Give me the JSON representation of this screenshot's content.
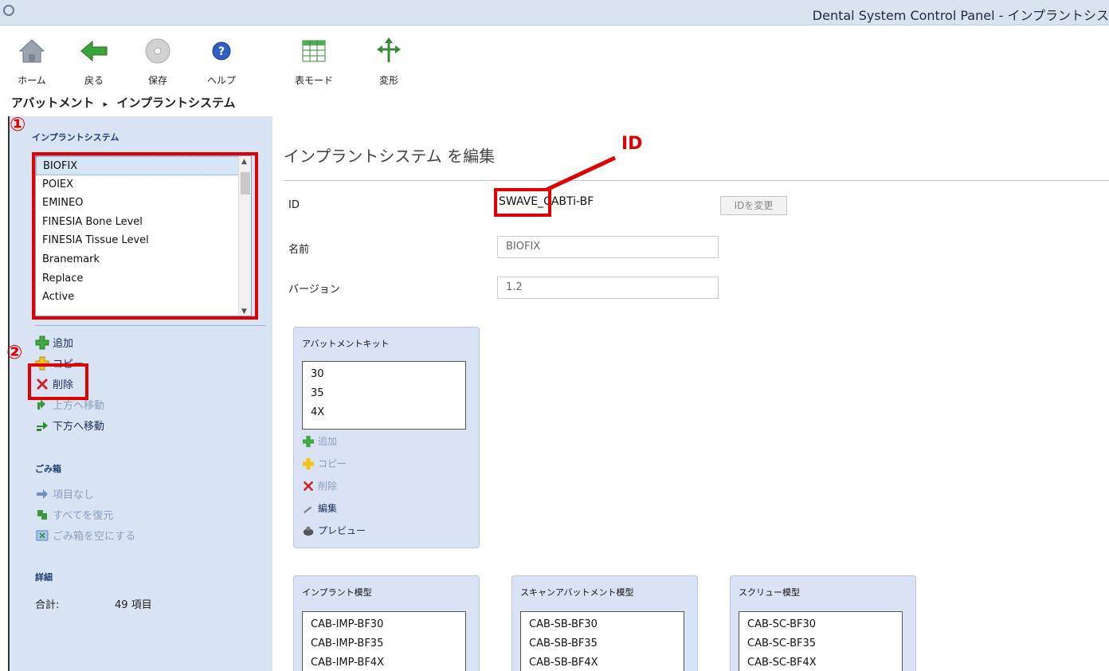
{
  "window": {
    "title": "Dental System Control Panel - インプラントシス"
  },
  "toolbar": {
    "home": "ホーム",
    "back": "戻る",
    "save": "保存",
    "help": "ヘルプ",
    "table_mode": "表モード",
    "transform": "変形"
  },
  "breadcrumb": {
    "parent": "アバットメント",
    "separator": "▸",
    "current": "インプラントシステム"
  },
  "left": {
    "section_title": "インプラントシステム",
    "systems": [
      "BIOFIX",
      "POIEX",
      "EMINEO",
      "FINESIA Bone Level",
      "FINESIA Tissue Level",
      "Branemark",
      "Replace",
      "Active"
    ],
    "selected": "BIOFIX",
    "actions": {
      "add": "追加",
      "copy": "コピー",
      "delete": "削除",
      "move_up": "上方へ移動",
      "move_down": "下方へ移動"
    },
    "trash_title": "ごみ箱",
    "trash": {
      "none": "項目なし",
      "restore_all": "すべてを復元",
      "empty": "ごみ箱を空にする"
    },
    "details_title": "詳細",
    "total_label": "合計:",
    "total_value": "49 項目"
  },
  "annotations": {
    "one": "①",
    "two": "②",
    "id": "ID"
  },
  "main": {
    "heading": "インプラントシステム を編集",
    "id_label": "ID",
    "id_value": "SWAVE_CABTi-BF",
    "id_change_button": "IDを変更",
    "name_label": "名前",
    "name_value": "BIOFIX",
    "version_label": "バージョン",
    "version_value": "1.2",
    "abutment_kit": {
      "title": "アバットメントキット",
      "items": [
        "30",
        "35",
        "4X"
      ],
      "actions": {
        "add": "追加",
        "copy": "コピー",
        "delete": "削除",
        "edit": "編集",
        "preview": "プレビュー"
      }
    },
    "implant_model": {
      "title": "インプラント模型",
      "items": [
        "CAB-IMP-BF30",
        "CAB-IMP-BF35",
        "CAB-IMP-BF4X"
      ]
    },
    "scan_abutment_model": {
      "title": "スキャンアバットメント模型",
      "items": [
        "CAB-SB-BF30",
        "CAB-SB-BF35",
        "CAB-SB-BF4X"
      ]
    },
    "screw_model": {
      "title": "スクリュー模型",
      "items": [
        "CAB-SC-BF30",
        "CAB-SC-BF35",
        "CAB-SC-BF4X"
      ]
    }
  },
  "colors": {
    "annotation_red": "#e00000",
    "panel_bg": "#d8e4f4",
    "header_blue": "#1f3d73"
  }
}
